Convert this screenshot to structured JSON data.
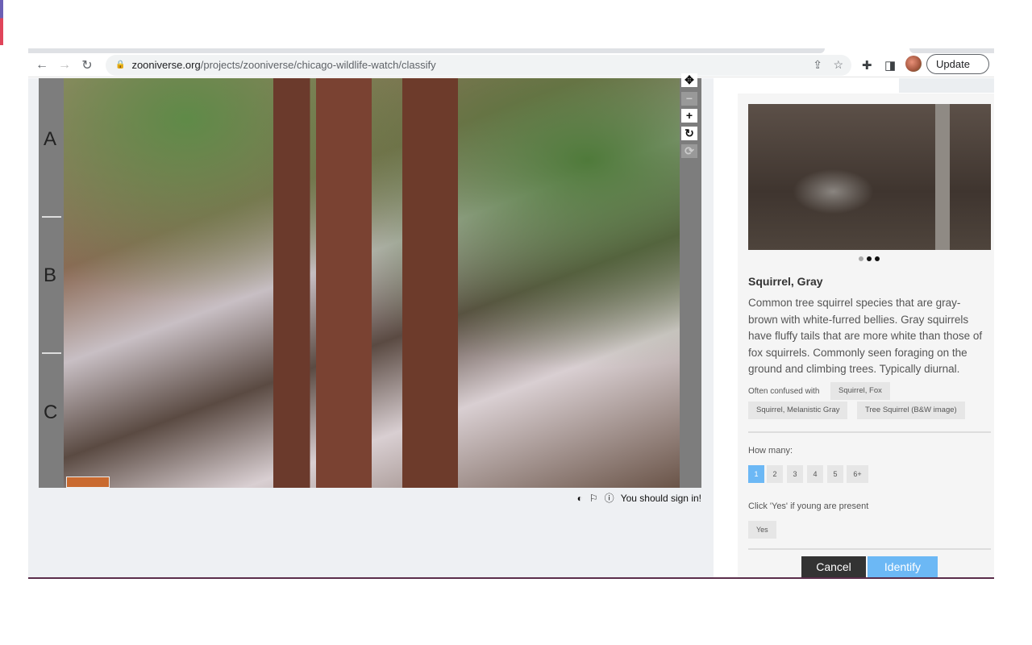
{
  "browser": {
    "url_domain": "zooniverse.org",
    "url_path": "/projects/zooniverse/chicago-wildlife-watch/classify",
    "update_label": "Update"
  },
  "subject": {
    "row_labels": [
      "A",
      "B",
      "C"
    ],
    "meta_text": "You should sign in!"
  },
  "species": {
    "title": "Squirrel, Gray",
    "description": "Common tree squirrel species that are gray-brown with white-furred bellies. Gray squirrels have fluffy tails that are more white than those of fox squirrels. Commonly seen foraging on the ground and climbing trees. Typically diurnal.",
    "confused_label": "Often confused with",
    "confused": [
      "Squirrel, Fox",
      "Squirrel, Melanistic Gray",
      "Tree Squirrel (B&W image)"
    ]
  },
  "how_many": {
    "label": "How many:",
    "options": [
      "1",
      "2",
      "3",
      "4",
      "5",
      "6+"
    ],
    "selected": "1"
  },
  "young": {
    "label": "Click 'Yes' if young are present",
    "yes": "Yes"
  },
  "actions": {
    "cancel": "Cancel",
    "identify": "Identify"
  },
  "colors": {
    "accent": "#6cb8f5",
    "cancel": "#333333"
  }
}
